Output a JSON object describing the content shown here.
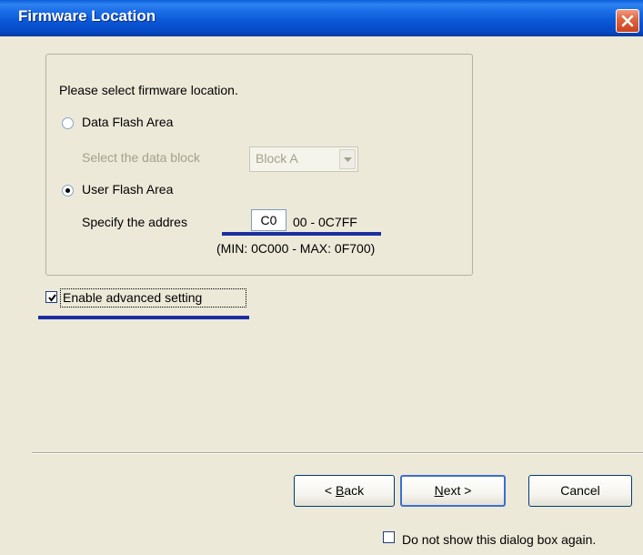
{
  "window": {
    "title": "Firmware Location"
  },
  "group": {
    "legend": "Please select firmware location.",
    "data_flash": {
      "label": "Data Flash Area",
      "selected": false
    },
    "data_block": {
      "label": "Select the data block",
      "value": "Block A",
      "enabled": false
    },
    "user_flash": {
      "label": "User Flash Area",
      "selected": true
    },
    "address": {
      "label": "Specify the addres",
      "value": "C0",
      "suffix": "00 - 0C7FF",
      "range_note": "(MIN: 0C000 - MAX: 0F700)"
    }
  },
  "advanced": {
    "label": "Enable advanced setting",
    "checked": true
  },
  "buttons": {
    "back": "< Back",
    "back_mnemonic": "B",
    "next": "Next >",
    "next_mnemonic": "N",
    "cancel": "Cancel"
  },
  "footer": {
    "dont_show_label": "Do not show this dialog box again.",
    "checked": false
  },
  "colors": {
    "title_bar": "#0a56d6",
    "dialog_bg": "#ece9d8",
    "highlight_underline": "#1b2ea0",
    "close_button": "#e2663f"
  }
}
